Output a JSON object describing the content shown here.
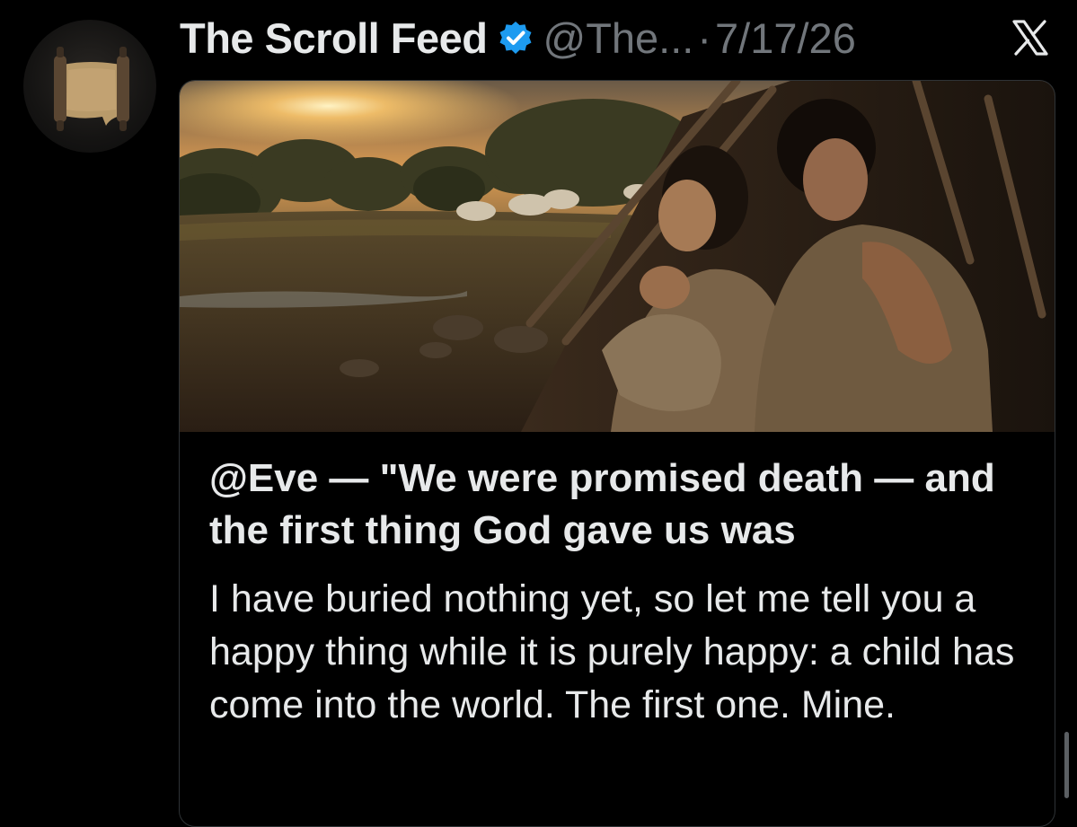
{
  "post": {
    "display_name": "The Scroll Feed",
    "handle": "@The...",
    "separator": "·",
    "date": "7/17/26"
  },
  "icons": {
    "avatar": "scroll-icon",
    "verified": "verified-badge-icon",
    "brand": "x-logo-icon",
    "verified_color": "#1d9bf0"
  },
  "card": {
    "image_alt": "Illustration of a woman and man cradling a newborn baby beside a hut at sunset, with sheep grazing in the field behind",
    "title": "@Eve — \"We were promised death — and the first thing God gave us was",
    "body": "I have buried nothing yet, so let me tell you a happy thing while it is purely happy: a child has come into the world. The first one. Mine."
  }
}
